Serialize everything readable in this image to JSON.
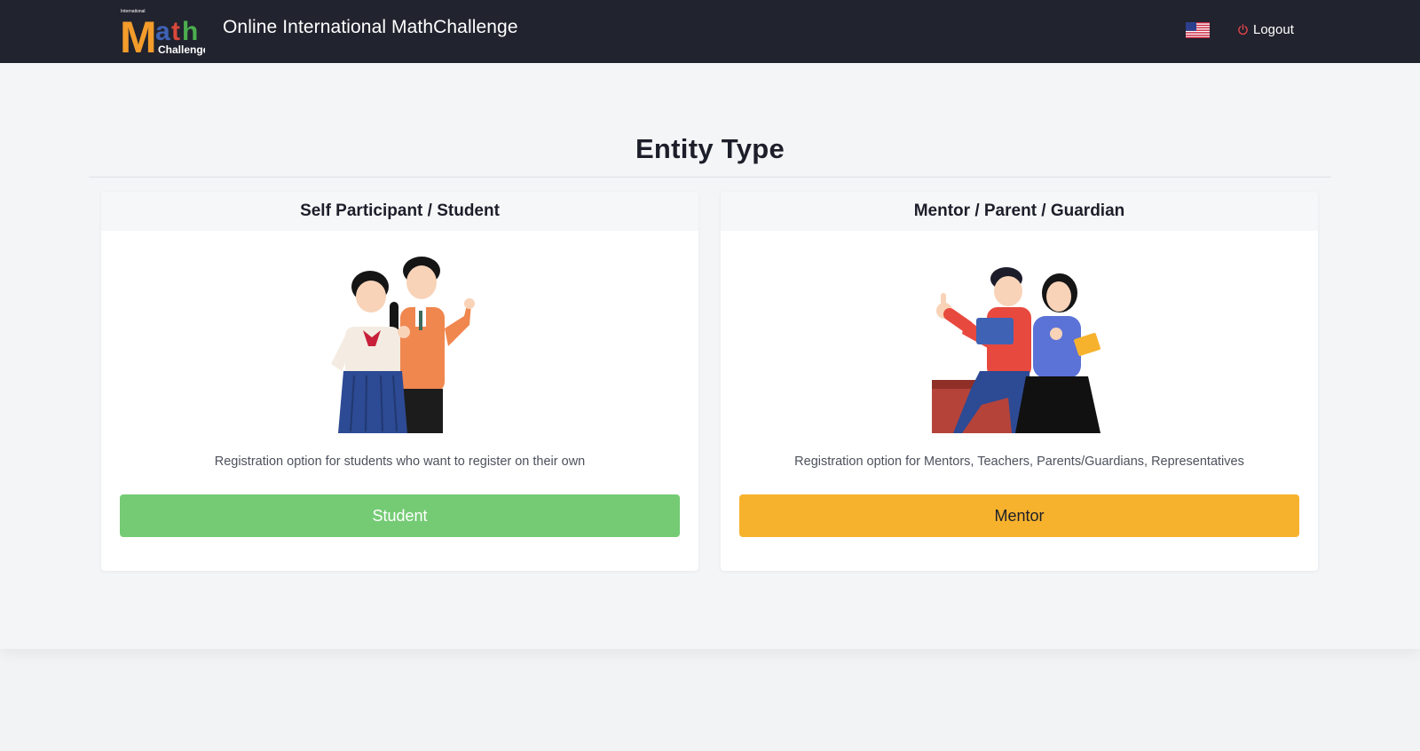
{
  "header": {
    "logo": {
      "text_small": "International",
      "text_big": "Math",
      "text_sub": "Challenge"
    },
    "title": "Online International MathChallenge",
    "language_icon": "us-flag-icon",
    "logout_label": "Logout",
    "logout_icon": "power-icon"
  },
  "page": {
    "title": "Entity Type"
  },
  "cards": [
    {
      "header": "Self Participant / Student",
      "description": "Registration option for students who want to register on their own",
      "button_label": "Student",
      "button_color": "#74cb74",
      "illustration": "students-illustration"
    },
    {
      "header": "Mentor / Parent / Guardian",
      "description": "Registration option for Mentors, Teachers, Parents/Guardians, Representatives",
      "button_label": "Mentor",
      "button_color": "#f7b22d",
      "illustration": "mentors-illustration"
    }
  ],
  "colors": {
    "topbar": "#21232e",
    "background": "#f2f3f5",
    "student_green": "#74cb74",
    "mentor_orange": "#f7b22d"
  }
}
